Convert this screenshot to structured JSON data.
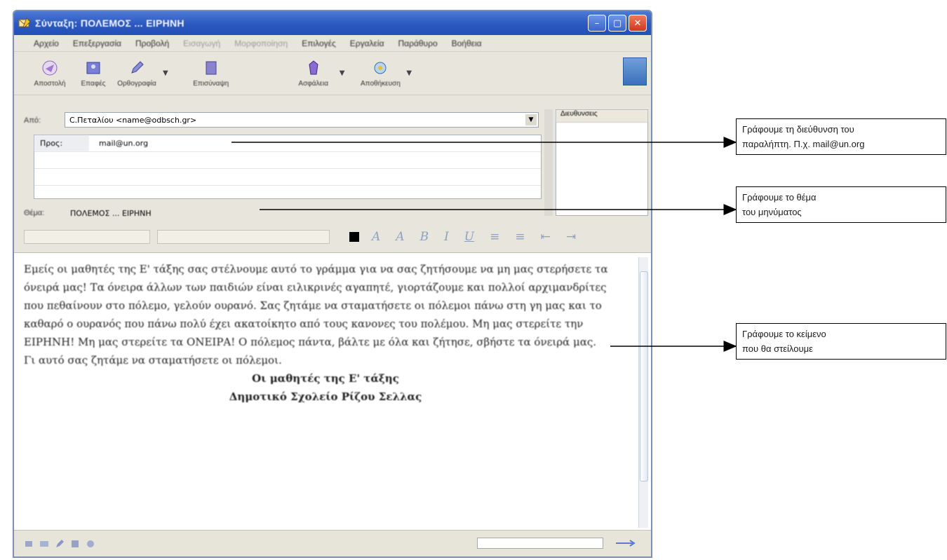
{
  "window": {
    "title": "Σύνταξη: ΠΟΛΕΜΟΣ ... ΕΙΡΗΝΗ",
    "controls": [
      "minimize",
      "maximize",
      "close"
    ]
  },
  "menu": {
    "items": [
      {
        "label": "Αρχείο",
        "enabled": true
      },
      {
        "label": "Επεξεργασία",
        "enabled": true
      },
      {
        "label": "Προβολή",
        "enabled": true
      },
      {
        "label": "Εισαγωγή",
        "enabled": false
      },
      {
        "label": "Μορφοποίηση",
        "enabled": false
      },
      {
        "label": "Επιλογές",
        "enabled": true
      },
      {
        "label": "Εργαλεία",
        "enabled": true
      },
      {
        "label": "Παράθυρο",
        "enabled": true
      },
      {
        "label": "Βοήθεια",
        "enabled": true
      }
    ]
  },
  "toolbar": {
    "send": "Αποστολή",
    "contacts": "Επαφές",
    "spelling": "Ορθογραφία",
    "attach": "Επισύναψη",
    "security": "Ασφάλεια",
    "save": "Αποθήκευση"
  },
  "header": {
    "from_label": "Από:",
    "from_value": "C.Πεταλίου <name@odbsch.gr>",
    "to_type": "Προς:",
    "to_value": "mail@un.org",
    "subject_label": "Θέμα:",
    "subject_value": "ΠΟΛΕΜΟΣ ... ΕΙΡΗΝΗ"
  },
  "contacts_panel": {
    "title": "Διευθυνσεις"
  },
  "message": {
    "paragraphs": [
      "Εμείς οι μαθητές της Ε' τάξης σας στέλνουμε αυτό το γράμμα για να σας ζητήσουμε να μη μας στερήσετε τα όνειρά μας! Τα όνειρα άλλων των παιδιών είναι ειλικρινές αγαπητέ, γιορτάζουμε και πολλοί αρχιμανδρίτες που πεθαίνουν στο πόλεμο, γελούν ουρανό. Σας ζητάμε να σταματήσετε οι πόλεμοι πάνω στη γη μας και το καθαρό ο ουρανός που πάνω πολύ έχει ακατοίκητο από τους κανονες του πολέμου. Μη μας στερείτε την ΕΙΡΗΝΗ! Μη μας στερείτε τα ΟΝΕΙΡΑ! Ο πόλεμος πάντα, βάλτε με όλα και ζήτησε, σβήστε τα όνειρά μας.",
      "Γι αυτό σας ζητάμε να σταματήσετε οι πόλεμοι."
    ],
    "signature": "Οι μαθητές της Ε' τάξης",
    "school": "Δημοτικό Σχολείο Ρίζου Σελλας"
  },
  "callouts": [
    {
      "lines": [
        "Γράφουμε τη διεύθυνση του",
        "παραλήπτη. Π.χ. mail@un.org"
      ]
    },
    {
      "lines": [
        "Γράφουμε το θέμα",
        "του μηνύματος"
      ]
    },
    {
      "lines": [
        "Γράφουμε το κείμενο",
        "που θα στείλουμε"
      ]
    }
  ]
}
